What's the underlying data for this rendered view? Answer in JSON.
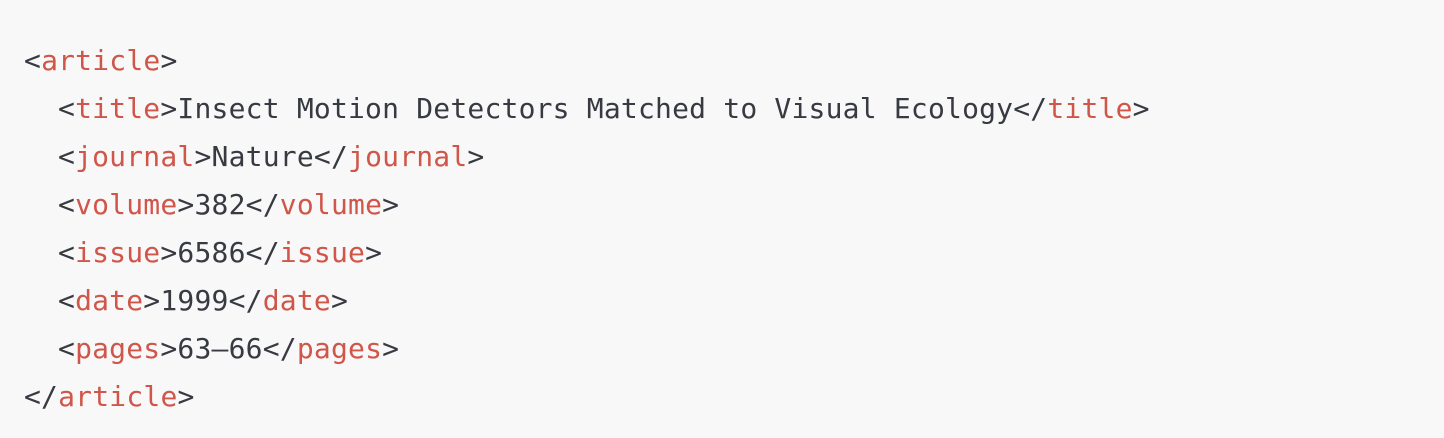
{
  "code": {
    "root_tag": "article",
    "lines": [
      {
        "tag": "title",
        "value": "Insect Motion Detectors Matched to Visual Ecology"
      },
      {
        "tag": "journal",
        "value": "Nature"
      },
      {
        "tag": "volume",
        "value": "382"
      },
      {
        "tag": "issue",
        "value": "6586"
      },
      {
        "tag": "date",
        "value": "1999"
      },
      {
        "tag": "pages",
        "value": "63–66"
      }
    ]
  },
  "colors": {
    "background": "#f8f8f8",
    "tag": "#d0564a",
    "text": "#383a42"
  }
}
